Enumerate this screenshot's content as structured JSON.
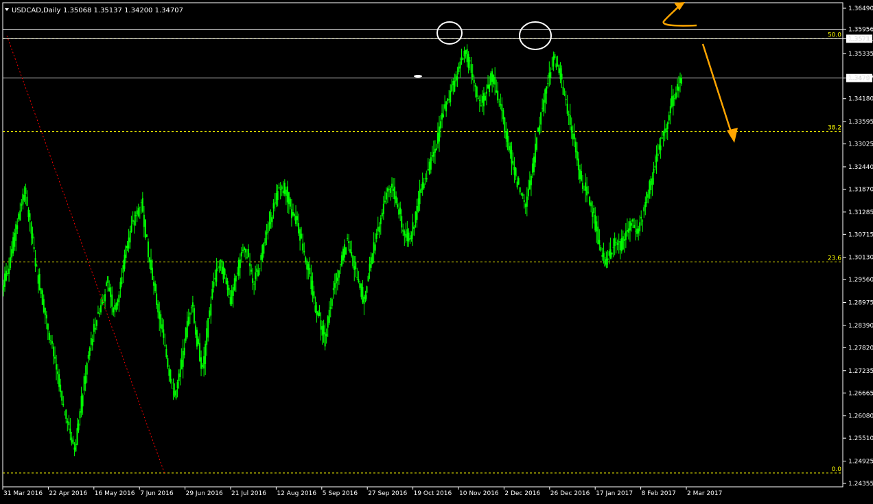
{
  "header": {
    "symbol": "USDCAD,Daily",
    "ohlc": "1.35068 1.35137 1.34200 1.34707"
  },
  "colors": {
    "background": "#000000",
    "candle": "#00ff00",
    "axis": "#ffffff",
    "fib": "#ffff00",
    "annotation": "#ffa500",
    "trendline": "#ff0000"
  },
  "chart_data": {
    "type": "candlestick",
    "title": "USDCAD,Daily",
    "ylim": [
      1.24355,
      1.3649
    ],
    "y_ticks": [
      "1.36490",
      "1.35956",
      "1.35711",
      "1.35335",
      "1.34707",
      "1.34180",
      "1.33595",
      "1.33025",
      "1.32440",
      "1.31870",
      "1.31285",
      "1.30715",
      "1.30130",
      "1.29560",
      "1.28975",
      "1.28390",
      "1.27820",
      "1.27235",
      "1.26665",
      "1.26080",
      "1.25510",
      "1.24925",
      "1.24355"
    ],
    "x_ticks": [
      "31 Mar 2016",
      "22 Apr 2016",
      "16 May 2016",
      "7 Jun 2016",
      "29 Jun 2016",
      "21 Jul 2016",
      "12 Aug 2016",
      "5 Sep 2016",
      "27 Sep 2016",
      "19 Oct 2016",
      "10 Nov 2016",
      "2 Dec 2016",
      "26 Dec 2016",
      "17 Jan 2017",
      "8 Feb 2017",
      "2 Mar 2017"
    ],
    "current_price": 1.34707,
    "fibonacci": [
      {
        "label": "0.0",
        "price": 1.2462
      },
      {
        "label": "23.6",
        "price": 1.3001
      },
      {
        "label": "38.2",
        "price": 1.3334
      },
      {
        "label": "50.0",
        "price": 1.35711
      }
    ],
    "horizontal_lines": [
      1.35956,
      1.35711,
      1.34707
    ],
    "closes": [
      1.298,
      1.305,
      1.312,
      1.318,
      1.31,
      1.3,
      1.292,
      1.285,
      1.278,
      1.27,
      1.262,
      1.258,
      1.252,
      1.262,
      1.272,
      1.28,
      1.286,
      1.29,
      1.295,
      1.288,
      1.292,
      1.302,
      1.308,
      1.312,
      1.316,
      1.305,
      1.295,
      1.288,
      1.28,
      1.272,
      1.266,
      1.272,
      1.282,
      1.29,
      1.28,
      1.272,
      1.285,
      1.295,
      1.3,
      1.296,
      1.29,
      1.296,
      1.303,
      1.302,
      1.295,
      1.298,
      1.305,
      1.31,
      1.316,
      1.32,
      1.318,
      1.312,
      1.31,
      1.304,
      1.298,
      1.29,
      1.285,
      1.28,
      1.29,
      1.296,
      1.301,
      1.306,
      1.3,
      1.295,
      1.29,
      1.299,
      1.306,
      1.312,
      1.318,
      1.32,
      1.314,
      1.308,
      1.306,
      1.31,
      1.318,
      1.322,
      1.326,
      1.33,
      1.338,
      1.341,
      1.345,
      1.35,
      1.354,
      1.35,
      1.344,
      1.34,
      1.344,
      1.348,
      1.342,
      1.336,
      1.33,
      1.323,
      1.318,
      1.314,
      1.322,
      1.332,
      1.34,
      1.347,
      1.352,
      1.349,
      1.342,
      1.336,
      1.328,
      1.32,
      1.318,
      1.313,
      1.306,
      1.3,
      1.302,
      1.306,
      1.304,
      1.307,
      1.31,
      1.308,
      1.312,
      1.318,
      1.324,
      1.33,
      1.334,
      1.34,
      1.344,
      1.347
    ]
  }
}
